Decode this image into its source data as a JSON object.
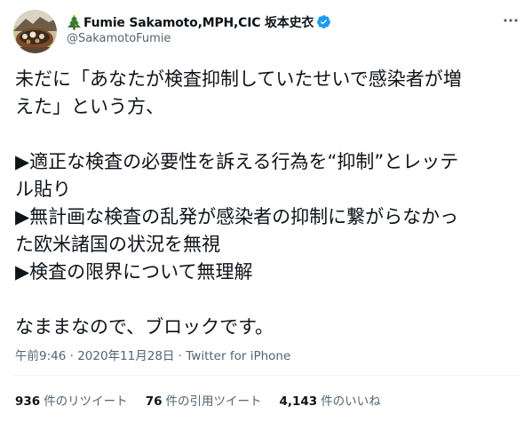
{
  "author": {
    "display_name": "Fumie Sakamoto,MPH,CIC 坂本史衣",
    "handle": "@SakamotoFumie",
    "name_emoji_icon": "christmas-tree-icon",
    "verified_icon": "verified-badge-icon"
  },
  "tweet": {
    "lines": [
      "未だに「あなたが検査抑制していたせいで感染者が増",
      "えた」という方、",
      "",
      "▶適正な検査の必要性を訴える行為を“抑制”とレッテ",
      "ル貼り",
      "▶無計画な検査の乱発が感染者の抑制に繋がらなかっ",
      "た欧米諸国の状況を無視",
      "▶検査の限界について無理解",
      "",
      "なままなので、ブロックです。"
    ]
  },
  "meta": {
    "time": "午前9:46",
    "separator1": " · ",
    "date": "2020年11月28日",
    "separator2": " · ",
    "source": "Twitter for iPhone"
  },
  "stats": {
    "retweets_value": "936",
    "retweets_label": "件のリツイート",
    "quotes_value": "76",
    "quotes_label": "件の引用ツイート",
    "likes_value": "4,143",
    "likes_label": "件のいいね"
  },
  "colors": {
    "text_primary": "#0f1419",
    "text_secondary": "#536471",
    "verified_blue": "#1d9bf0",
    "divider": "#eff3f4"
  },
  "icons": {
    "more": "more-dots-icon"
  }
}
